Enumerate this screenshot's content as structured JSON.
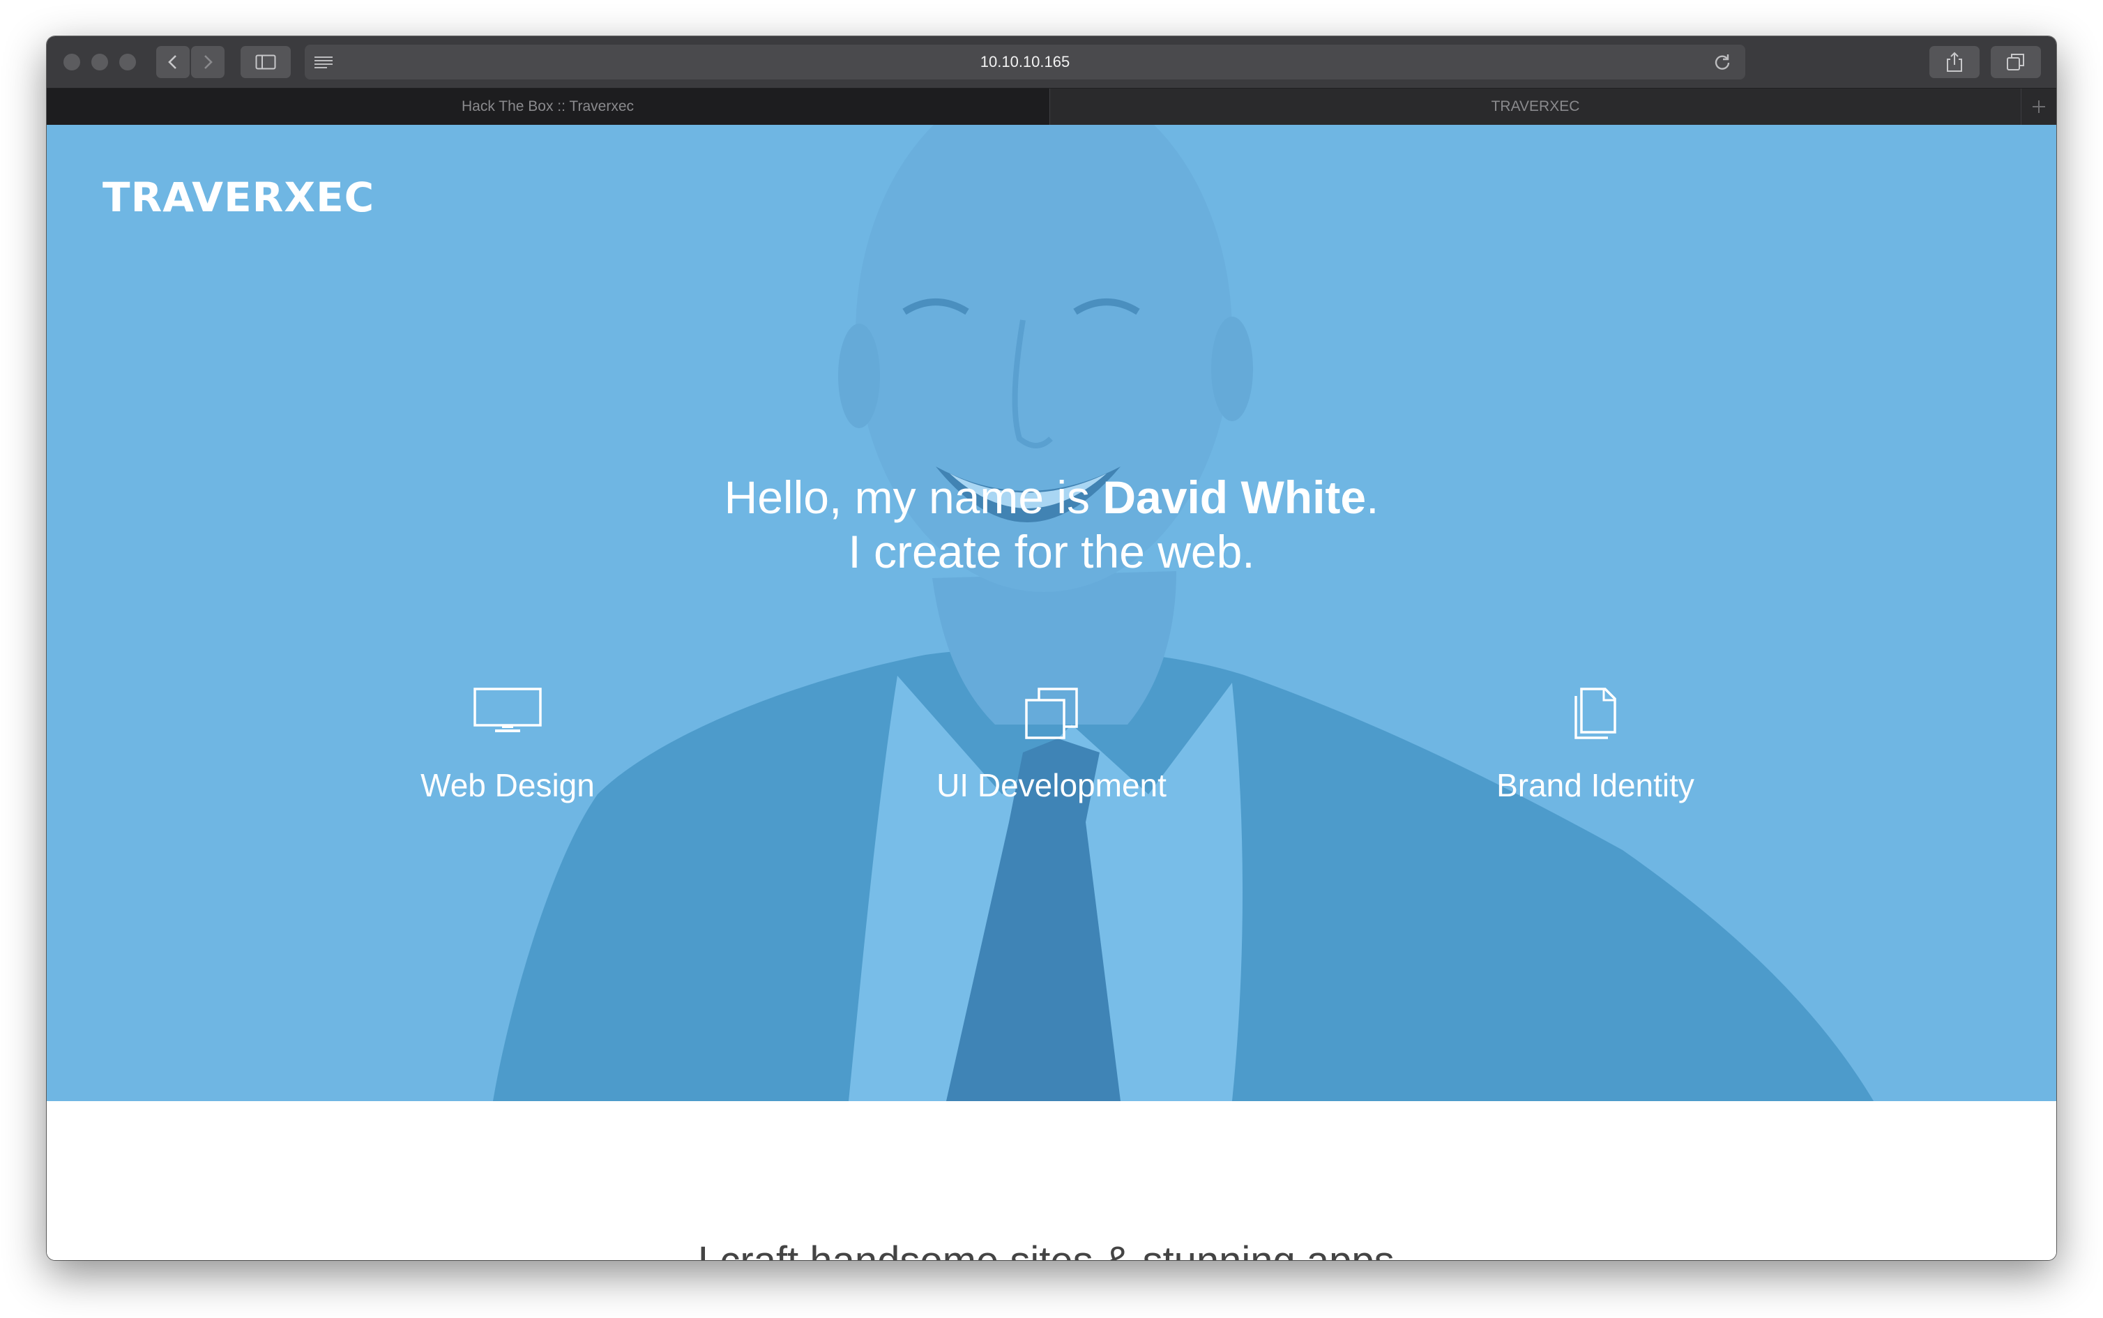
{
  "browser": {
    "url": "10.10.10.165",
    "tabs": [
      {
        "label": "Hack The Box :: Traverxec"
      },
      {
        "label": "TRAVERXEC"
      }
    ]
  },
  "site": {
    "logo": "TRAVERXEC",
    "hero": {
      "greeting_prefix": "Hello, my name is ",
      "name": "David White",
      "greeting_suffix": ".",
      "tagline_line2": "I create for the web.",
      "services": [
        {
          "label": "Web Design",
          "icon": "monitor-icon"
        },
        {
          "label": "UI Development",
          "icon": "layered-squares-icon"
        },
        {
          "label": "Brand Identity",
          "icon": "documents-icon"
        }
      ]
    },
    "section_heading": "I craft handsome sites & stunning apps."
  },
  "colors": {
    "hero_overlay": "#6fb6e3",
    "chrome": "#3b3b3e"
  }
}
